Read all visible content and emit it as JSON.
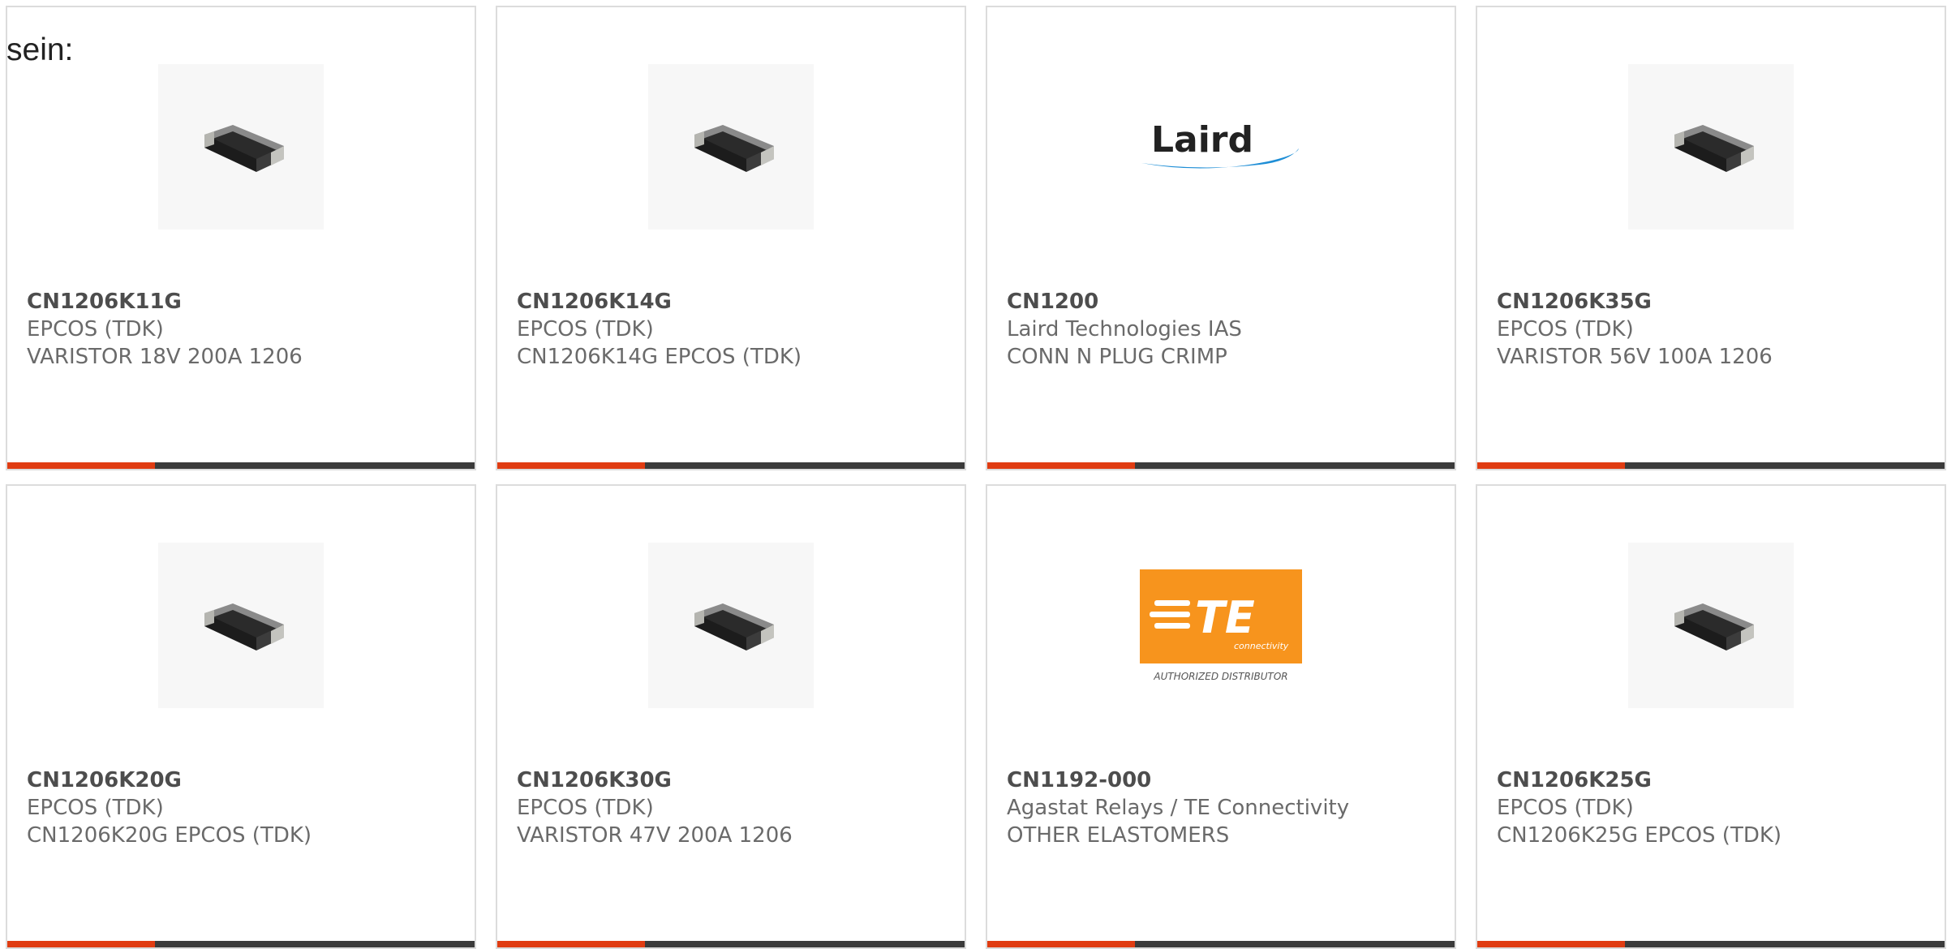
{
  "intro_text": "sein:",
  "colors": {
    "accent_bar": "#e03c12",
    "bar": "#3b3b3b",
    "card_border": "#dcdcdc",
    "te_orange": "#f7941d",
    "laird_blue": "#1e8ed6"
  },
  "products": [
    {
      "part_number": "CN1206K11G",
      "manufacturer": "EPCOS (TDK)",
      "description": "VARISTOR 18V 200A 1206",
      "image": "smd-chip-image"
    },
    {
      "part_number": "CN1206K14G",
      "manufacturer": "EPCOS (TDK)",
      "description": "CN1206K14G EPCOS (TDK)",
      "image": "smd-chip-image"
    },
    {
      "part_number": "CN1200",
      "manufacturer": "Laird Technologies IAS",
      "description": "CONN N PLUG CRIMP",
      "image": "laird-logo",
      "logo_text": "Laird"
    },
    {
      "part_number": "CN1206K35G",
      "manufacturer": "EPCOS (TDK)",
      "description": "VARISTOR 56V 100A 1206",
      "image": "smd-chip-image"
    },
    {
      "part_number": "CN1206K20G",
      "manufacturer": "EPCOS (TDK)",
      "description": "CN1206K20G EPCOS (TDK)",
      "image": "smd-chip-image"
    },
    {
      "part_number": "CN1206K30G",
      "manufacturer": "EPCOS (TDK)",
      "description": "VARISTOR 47V 200A 1206",
      "image": "smd-chip-image"
    },
    {
      "part_number": "CN1192-000",
      "manufacturer": "Agastat Relays / TE Connectivity",
      "description": "OTHER ELASTOMERS",
      "image": "te-connectivity-logo",
      "logo_text": "TE",
      "logo_subtext": "connectivity",
      "logo_caption": "AUTHORIZED DISTRIBUTOR"
    },
    {
      "part_number": "CN1206K25G",
      "manufacturer": "EPCOS (TDK)",
      "description": "CN1206K25G EPCOS (TDK)",
      "image": "smd-chip-image"
    }
  ]
}
